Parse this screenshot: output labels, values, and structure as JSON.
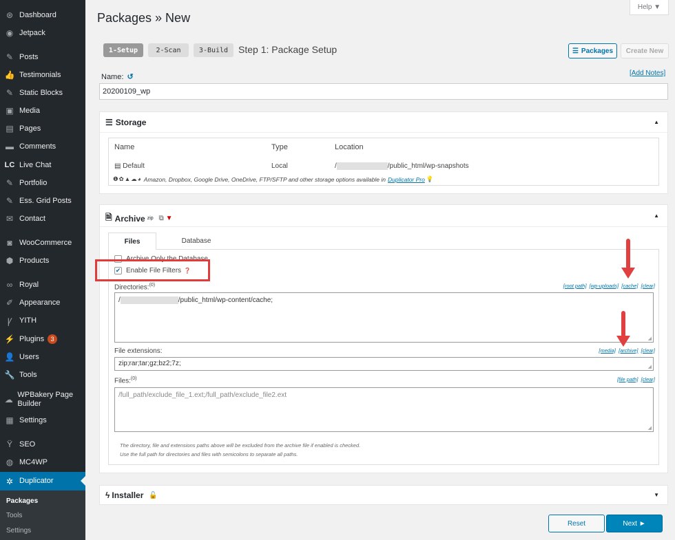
{
  "sidebar": {
    "items": [
      {
        "label": "Dashboard",
        "icon": "dashboard-icon",
        "glyph": "⊛"
      },
      {
        "label": "Jetpack",
        "icon": "jetpack-icon",
        "glyph": "◉"
      },
      {
        "label": "Posts",
        "icon": "pin-icon",
        "glyph": "✎"
      },
      {
        "label": "Testimonials",
        "icon": "thumbs-up-icon",
        "glyph": "👍"
      },
      {
        "label": "Static Blocks",
        "icon": "pin-icon",
        "glyph": "✎"
      },
      {
        "label": "Media",
        "icon": "media-icon",
        "glyph": "▣"
      },
      {
        "label": "Pages",
        "icon": "pages-icon",
        "glyph": "▤"
      },
      {
        "label": "Comments",
        "icon": "comments-icon",
        "glyph": "▬"
      },
      {
        "label": "Live Chat",
        "icon": "livechat-logo-icon",
        "glyph": "LC"
      },
      {
        "label": "Portfolio",
        "icon": "pin-icon",
        "glyph": "✎"
      },
      {
        "label": "Ess. Grid Posts",
        "icon": "pin-icon",
        "glyph": "✎"
      },
      {
        "label": "Contact",
        "icon": "envelope-icon",
        "glyph": "✉"
      },
      {
        "label": "WooCommerce",
        "icon": "woocommerce-icon",
        "glyph": "◙"
      },
      {
        "label": "Products",
        "icon": "products-icon",
        "glyph": "⬢"
      },
      {
        "label": "Royal",
        "icon": "royal-icon",
        "glyph": "∞"
      },
      {
        "label": "Appearance",
        "icon": "brush-icon",
        "glyph": "✐"
      },
      {
        "label": "YITH",
        "icon": "yith-icon",
        "glyph": "Ꝩ"
      },
      {
        "label": "Plugins",
        "icon": "plug-icon",
        "glyph": "⚡",
        "badge": "3"
      },
      {
        "label": "Users",
        "icon": "user-icon",
        "glyph": "👤"
      },
      {
        "label": "Tools",
        "icon": "wrench-icon",
        "glyph": "🔧"
      },
      {
        "label": "WPBakery Page Builder",
        "icon": "wpbakery-icon",
        "glyph": "☁"
      },
      {
        "label": "Settings",
        "icon": "settings-icon",
        "glyph": "▦"
      },
      {
        "label": "SEO",
        "icon": "yoast-icon",
        "glyph": "Ÿ"
      },
      {
        "label": "MC4WP",
        "icon": "mc4wp-icon",
        "glyph": "◍"
      },
      {
        "label": "Duplicator",
        "icon": "duplicator-icon",
        "glyph": "✲"
      }
    ],
    "submenu": [
      "Packages",
      "Tools",
      "Settings"
    ]
  },
  "header": {
    "help": "Help ▼",
    "title": "Packages » New",
    "steps": [
      "1-Setup",
      "2-Scan",
      "3-Build"
    ],
    "step_title": "Step 1: Package Setup",
    "packages_button": "Packages",
    "create_new_button": "Create New"
  },
  "name": {
    "label": "Name:",
    "undo_glyph": "↺",
    "add_notes": "[Add Notes]",
    "value": "20200109_wp"
  },
  "storage": {
    "title": "Storage",
    "columns": [
      "Name",
      "Type",
      "Location"
    ],
    "row": {
      "name": "Default",
      "type": "Local",
      "location_prefix": "/",
      "location_suffix": "/public_html/wp-snapshots"
    },
    "note": "Amazon, Dropbox, Google Drive, OneDrive, FTP/SFTP and other storage options available in",
    "note_link": "Duplicator Pro",
    "note_glyphs": "❶✿▲☁◕",
    "bulb": "💡"
  },
  "archive": {
    "title": "Archive",
    "title_sup": "zip",
    "tabs": [
      "Files",
      "Database"
    ],
    "archive_only_db": "Archive Only the Database",
    "enable_filters": "Enable File Filters",
    "enable_filters_checked": true,
    "directories": {
      "label": "Directories:",
      "count": "(0)",
      "links": [
        "[root path]",
        "[wp-uploads]",
        "[cache]",
        "[clear]"
      ],
      "value_prefix": "/",
      "value_suffix": "/public_html/wp-content/cache;"
    },
    "extensions": {
      "label": "File extensions:",
      "links": [
        "[media]",
        "[archive]",
        "[clear]"
      ],
      "value": "zip;rar;tar;gz;bz2;7z;"
    },
    "files": {
      "label": "Files:",
      "count": "(0)",
      "links": [
        "[file path]",
        "[clear]"
      ],
      "placeholder": "/full_path/exclude_file_1.ext;/full_path/exclude_file2.ext"
    },
    "notes": [
      "The directory, file and extensions paths above will be excluded from the archive file if enabled is checked.",
      "Use the full path for directories and files with semicolons to separate all paths."
    ]
  },
  "installer": {
    "title": "Installer"
  },
  "footer": {
    "reset": "Reset",
    "next": "Next ►"
  },
  "colors": {
    "sidebar_bg": "#23282d",
    "accent": "#0073aa",
    "primary_button": "#0085ba",
    "highlight_red": "#e23b3b"
  }
}
